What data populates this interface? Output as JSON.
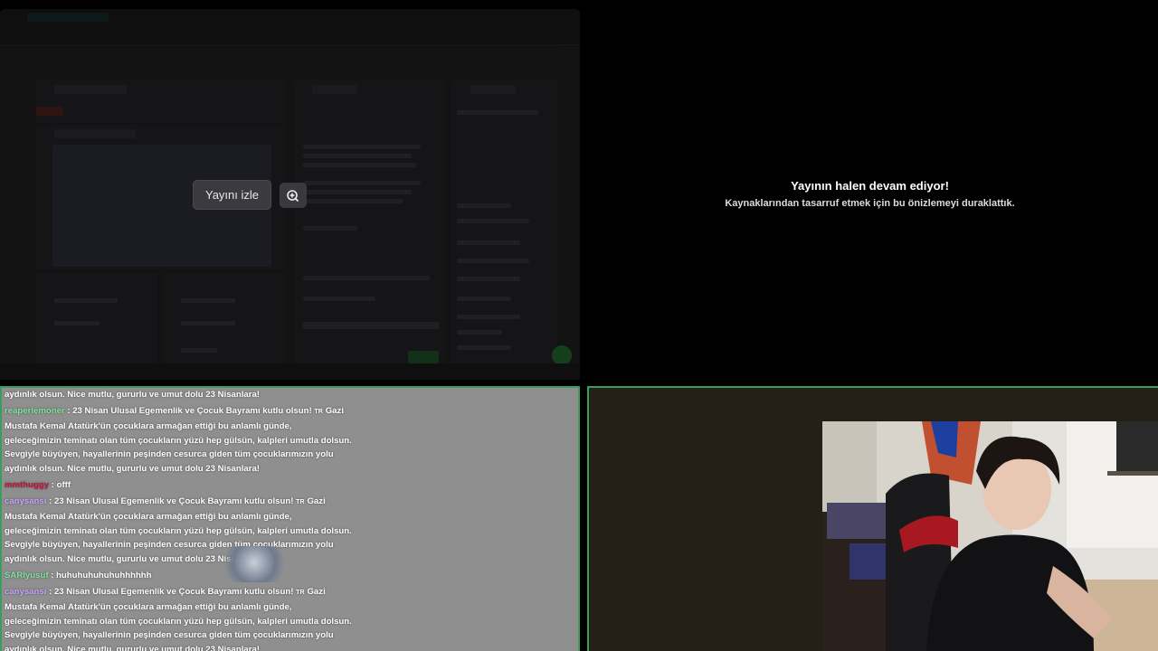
{
  "stream_preview": {
    "watch_button_label": "Yayını izle",
    "popout_icon": "popout-icon"
  },
  "paused_preview": {
    "title": "Yayının halen devam ediyor!",
    "subtitle": "Kaynaklarından tasarruf etmek için bu önizlemeyi duraklattık."
  },
  "chat": {
    "messages": [
      {
        "user": "",
        "user_color": "#ffffff",
        "flag": "",
        "lines": [
          "aydınlık olsun. Nice mutlu, gururlu ve umut dolu 23 Nisanlara!"
        ]
      },
      {
        "user": "reaperlemoner",
        "user_color": "#7fe3a1",
        "flag": "TR",
        "lines": [
          "23 Nisan Ulusal Egemenlik ve Çocuk Bayramı kutlu olsun!",
          "Gazi",
          "Mustafa Kemal Atatürk'ün çocuklara armağan ettiği bu anlamlı günde,",
          "geleceğimizin teminatı olan tüm çocukların yüzü hep gülsün, kalpleri umutla dolsun.",
          "Sevgiyle büyüyen, hayallerinin peşinden cesurca giden tüm çocuklarımızın yolu",
          "aydınlık olsun. Nice mutlu, gururlu ve umut dolu 23 Nisanlara!"
        ]
      },
      {
        "user": "mmthuggy",
        "user_color": "#c0143c",
        "flag": "",
        "lines": [
          "offf"
        ]
      },
      {
        "user": "canysansi",
        "user_color": "#caa3ff",
        "flag": "TR",
        "lines": [
          "23 Nisan Ulusal Egemenlik ve Çocuk Bayramı kutlu olsun!",
          "Gazi",
          "Mustafa Kemal Atatürk'ün çocuklara armağan ettiği bu anlamlı günde,",
          "geleceğimizin teminatı olan tüm çocukların yüzü hep gülsün, kalpleri umutla dolsun.",
          "Sevgiyle büyüyen, hayallerinin peşinden cesurca giden tüm çocuklarımızın yolu",
          "aydınlık olsun. Nice mutlu, gururlu ve umut dolu 23 Nisanlara!"
        ]
      },
      {
        "user": "SARIyusuf",
        "user_color": "#7fe3a1",
        "flag": "",
        "lines": [
          "huhuhuhuhuhuhhhhhh"
        ]
      },
      {
        "user": "canysansi",
        "user_color": "#caa3ff",
        "flag": "TR",
        "lines": [
          "23 Nisan Ulusal Egemenlik ve Çocuk Bayramı kutlu olsun!",
          "Gazi",
          "Mustafa Kemal Atatürk'ün çocuklara armağan ettiği bu anlamlı günde,",
          "geleceğimizin teminatı olan tüm çocukların yüzü hep gülsün, kalpleri umutla dolsun.",
          "Sevgiyle büyüyen, hayallerinin peşinden cesurca giden tüm çocuklarımızın yolu",
          "aydınlık olsun. Nice mutlu, gururlu ve umut dolu 23 Nisanlara!"
        ]
      }
    ]
  },
  "colors": {
    "border_accent": "#3a9c5e",
    "chat_background": "#8f8f8f",
    "cam_background": "#242018"
  }
}
